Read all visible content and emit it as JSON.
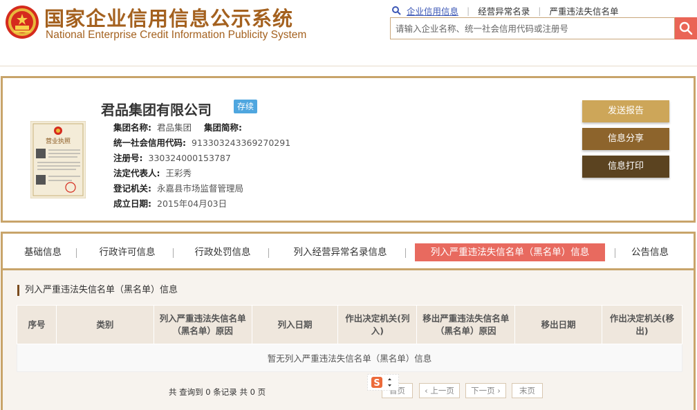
{
  "header": {
    "title_cn": "国家企业信用信息公示系统",
    "title_en": "National Enterprise Credit Information Publicity System",
    "links": [
      "企业信用信息",
      "经营异常名录",
      "严重违法失信名单"
    ],
    "search_placeholder": "请输入企业名称、统一社会信用代码或注册号"
  },
  "company": {
    "name": "君品集团有限公司",
    "status": "存续",
    "group_name_label": "集团名称:",
    "group_name": "君品集团",
    "group_short_label": "集团简称:",
    "credit_code_label": "统一社会信用代码:",
    "credit_code": "913303243369270291",
    "reg_no_label": "注册号:",
    "reg_no": "330324000153787",
    "legal_rep_label": "法定代表人:",
    "legal_rep": "王彩秀",
    "reg_authority_label": "登记机关:",
    "reg_authority": "永嘉县市场监督管理局",
    "established_label": "成立日期:",
    "established": "2015年04月03日",
    "license_text": "营业执照"
  },
  "actions": {
    "send_report": "发送报告",
    "share": "信息分享",
    "print": "信息打印"
  },
  "tabs": [
    {
      "label": "基础信息"
    },
    {
      "label": "行政许可信息"
    },
    {
      "label": "行政处罚信息"
    },
    {
      "label": "列入经营异常名录信息"
    },
    {
      "label": "列入严重违法失信名单（黑名单）信息"
    },
    {
      "label": "公告信息"
    }
  ],
  "section": {
    "title": "列入严重违法失信名单（黑名单）信息",
    "columns": [
      "序号",
      "类别",
      "列入严重违法失信名单（黑名单）原因",
      "列入日期",
      "作出决定机关(列入)",
      "移出严重违法失信名单（黑名单）原因",
      "移出日期",
      "作出决定机关(移出)"
    ],
    "empty_text": "暂无列入严重违法失信名单（黑名单）信息"
  },
  "pager": {
    "summary": "共 查询到 0 条记录 共 0 页",
    "first": "首页",
    "prev": "‹ 上一页",
    "next": "下一页 ›",
    "last": "末页"
  },
  "colors": {
    "brand": "#a4611f",
    "border_gold": "#c8a46a",
    "active_tab": "#e86a5f",
    "status_badge": "#4fa6df",
    "search_button": "#ea6556"
  }
}
